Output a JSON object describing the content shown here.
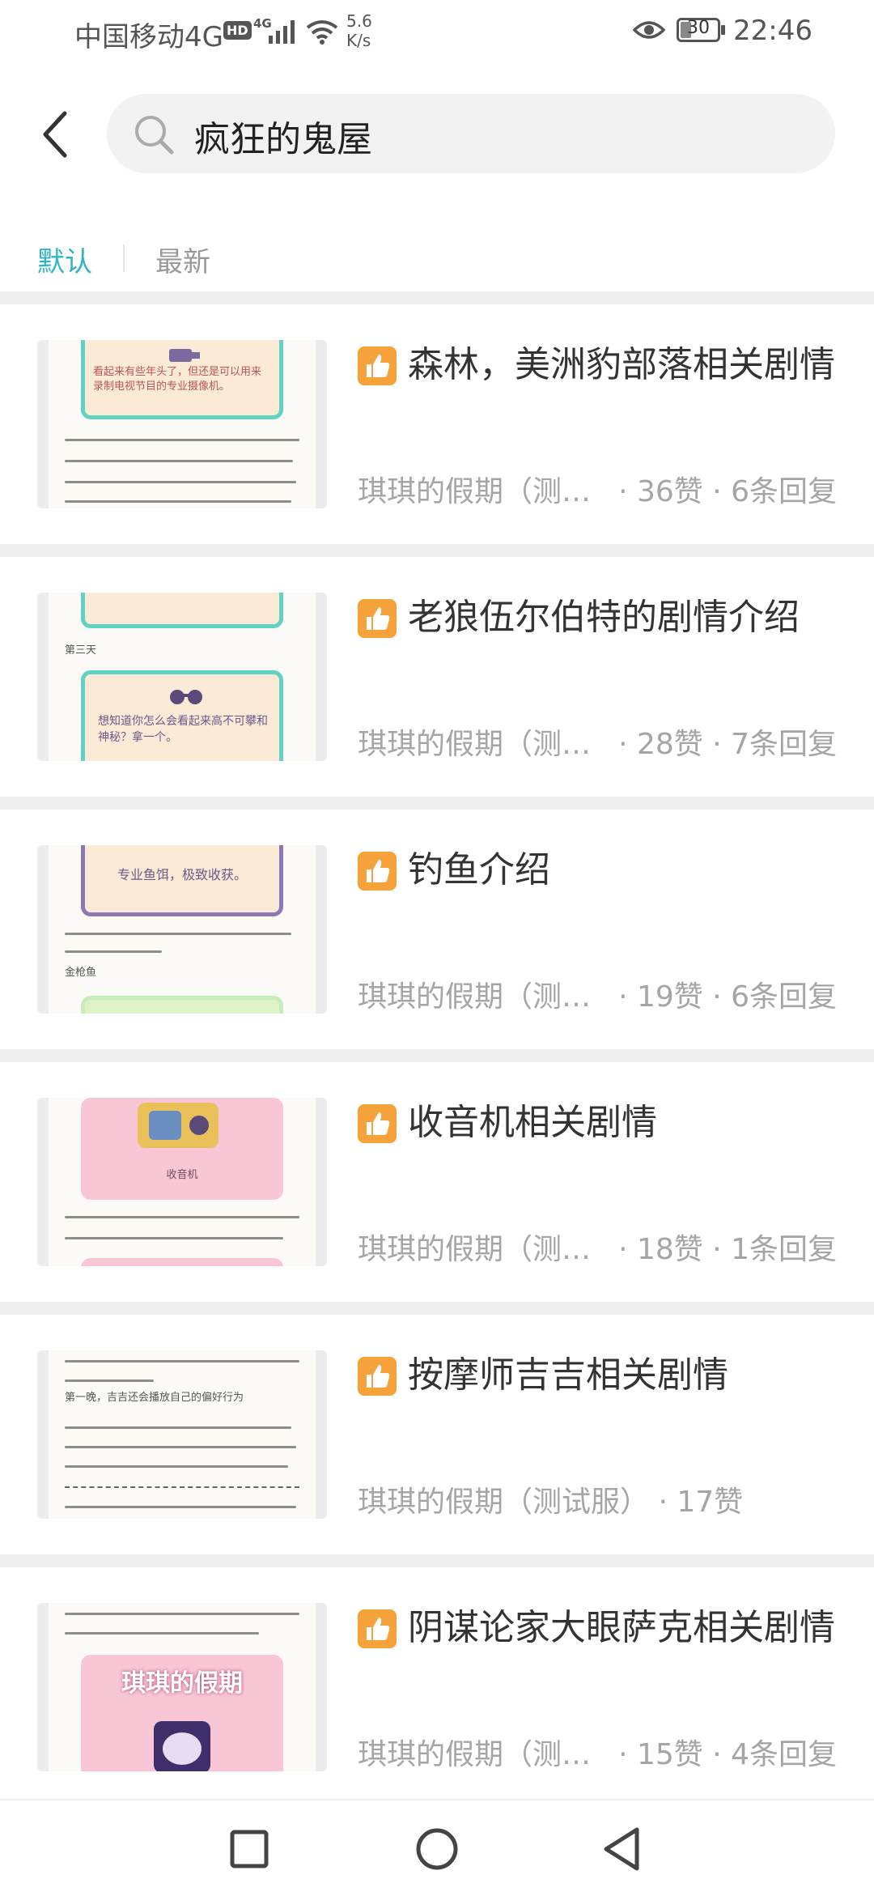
{
  "status_bar": {
    "carrier": "中国移动4G",
    "hd_badge": "HD",
    "network_type": "4G",
    "speed_value": "5.6",
    "speed_unit": "K/s",
    "battery": "30",
    "battery_level_pct": 30,
    "time": "22:46"
  },
  "header": {
    "back_icon": "chevron-left-icon",
    "search_icon": "search-icon",
    "search_query": "疯狂的鬼屋"
  },
  "tabs": [
    {
      "label": "默认",
      "active": true
    },
    {
      "label": "最新",
      "active": false
    }
  ],
  "posts": [
    {
      "title": "森林，美洲豹部落相关剧情",
      "source": "琪琪的假期（测试服）",
      "stats": "· 36赞 · 6条回复"
    },
    {
      "title": "老狼伍尔伯特的剧情介绍",
      "source": "琪琪的假期（测试服）",
      "stats": "· 28赞 · 7条回复"
    },
    {
      "title": "钓鱼介绍",
      "source": "琪琪的假期（测试服）",
      "stats": "· 19赞 · 6条回复"
    },
    {
      "title": "收音机相关剧情",
      "source": "琪琪的假期（测试服）",
      "stats": "· 18赞 · 1条回复"
    },
    {
      "title": "按摩师吉吉相关剧情",
      "source": "琪琪的假期（测试服）",
      "stats": "· 17赞"
    },
    {
      "title": "阴谋论家大眼萨克相关剧情",
      "source": "琪琪的假期（测试服）",
      "stats": "· 15赞 · 4条回复"
    }
  ],
  "thumbnail_texts": [
    {
      "text": "看起来有些年头了，但还是可以用来录制电视节目的专业摄像机。"
    },
    {
      "text": "想知道你怎么会看起来高不可攀和神秘？拿一个。",
      "label": "第三天"
    },
    {
      "text": "专业鱼饵，极致收获。",
      "label": "金枪鱼"
    },
    {
      "text": "收音机"
    },
    {
      "text": "第一晚，吉吉还会播放自己的偏好行为"
    },
    {
      "text": "琪琪的假期"
    }
  ],
  "navbar": {
    "recent_icon": "square-icon",
    "home_icon": "circle-icon",
    "back_icon": "triangle-back-icon"
  },
  "colors": {
    "accent": "#2eb5c4",
    "like_badge": "#f5a23a",
    "separator": "#efefef",
    "meta_text": "#a5a5a5"
  }
}
